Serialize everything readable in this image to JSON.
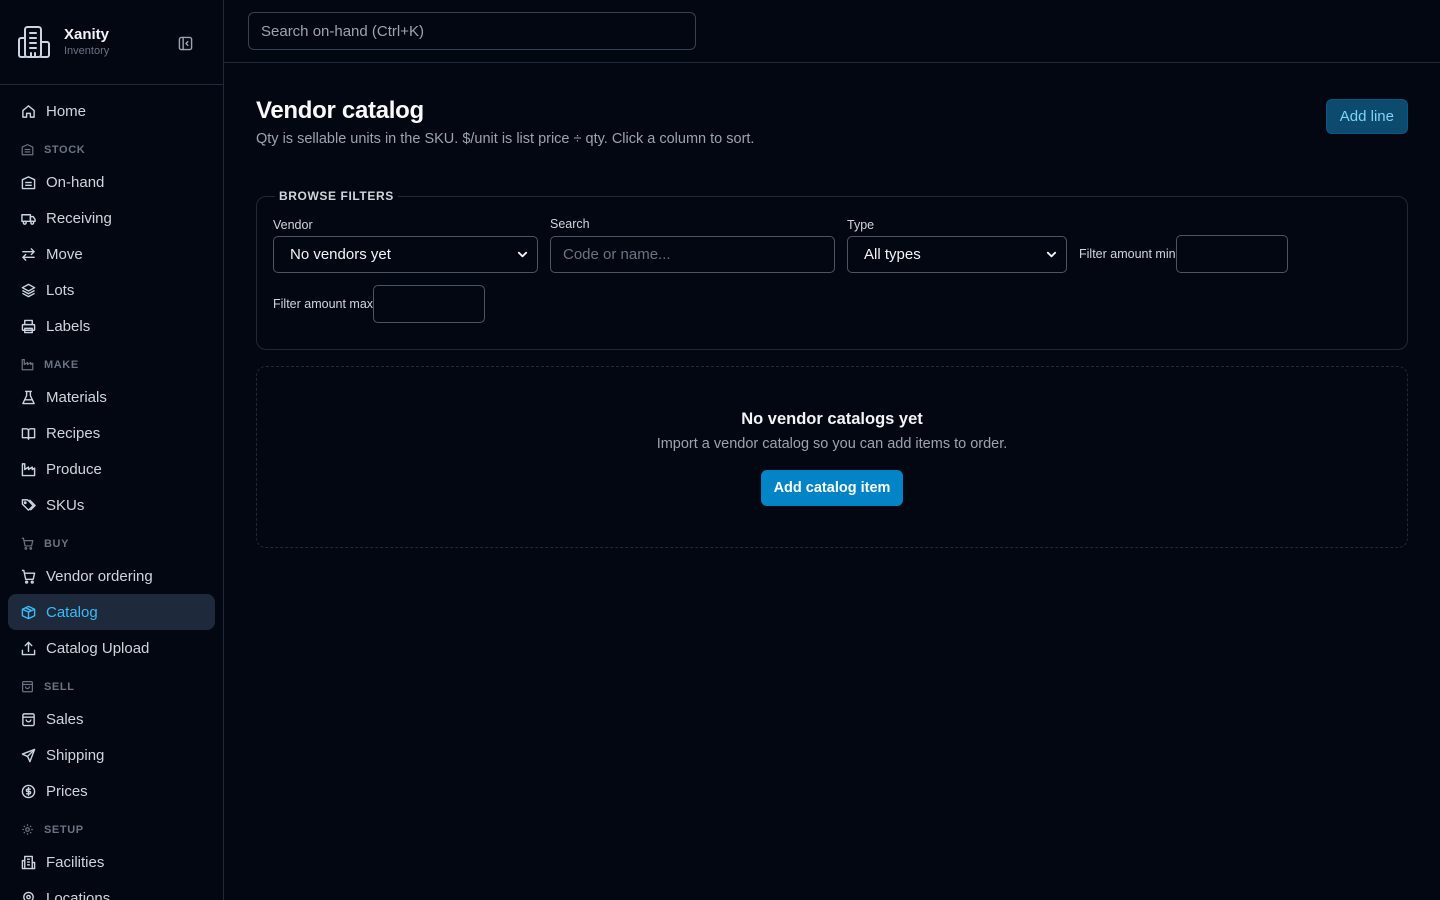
{
  "brand": {
    "name": "Xanity",
    "subtitle": "Inventory"
  },
  "search": {
    "placeholder": "Search on-hand (Ctrl+K)"
  },
  "sidebar": {
    "home": {
      "label": "Home",
      "icon": "home-icon"
    },
    "sections": [
      {
        "label": "STOCK",
        "icon": "warehouse-icon",
        "items": [
          {
            "label": "On-hand",
            "icon": "warehouse-icon"
          },
          {
            "label": "Receiving",
            "icon": "truck-icon"
          },
          {
            "label": "Move",
            "icon": "arrows-left-right-icon"
          },
          {
            "label": "Lots",
            "icon": "layers-icon"
          },
          {
            "label": "Labels",
            "icon": "printer-icon"
          }
        ]
      },
      {
        "label": "MAKE",
        "icon": "factory-icon",
        "items": [
          {
            "label": "Materials",
            "icon": "flask-icon"
          },
          {
            "label": "Recipes",
            "icon": "book-open-icon"
          },
          {
            "label": "Produce",
            "icon": "factory-icon"
          },
          {
            "label": "SKUs",
            "icon": "tags-icon"
          }
        ]
      },
      {
        "label": "BUY",
        "icon": "cart-icon",
        "items": [
          {
            "label": "Vendor ordering",
            "icon": "cart-icon"
          },
          {
            "label": "Catalog",
            "icon": "package-icon",
            "active": true
          },
          {
            "label": "Catalog Upload",
            "icon": "upload-icon"
          }
        ]
      },
      {
        "label": "SELL",
        "icon": "shopping-bag-icon",
        "items": [
          {
            "label": "Sales",
            "icon": "shopping-bag-icon"
          },
          {
            "label": "Shipping",
            "icon": "send-icon"
          },
          {
            "label": "Prices",
            "icon": "dollar-circle-icon"
          }
        ]
      },
      {
        "label": "SETUP",
        "icon": "gear-icon",
        "items": [
          {
            "label": "Facilities",
            "icon": "building-icon"
          },
          {
            "label": "Locations",
            "icon": "map-pin-icon"
          }
        ]
      }
    ]
  },
  "page": {
    "title": "Vendor catalog",
    "description": "Qty is sellable units in the SKU. $/unit is list price ÷ qty. Click a column to sort.",
    "add_line_label": "Add line"
  },
  "filters": {
    "legend": "BROWSE FILTERS",
    "vendor_label": "Vendor",
    "vendor_value": "No vendors yet",
    "search_label": "Search",
    "search_placeholder": "Code or name...",
    "type_label": "Type",
    "type_value": "All types",
    "min_label": "Filter amount min",
    "max_label": "Filter amount max"
  },
  "empty": {
    "title": "No vendor catalogs yet",
    "description": "Import a vendor catalog so you can add items to order.",
    "button_label": "Add catalog item"
  },
  "colors": {
    "background": "#030712",
    "accent": "#38bdf8",
    "primary_button": "#0284c7",
    "active_nav_bg": "#1e293b"
  }
}
